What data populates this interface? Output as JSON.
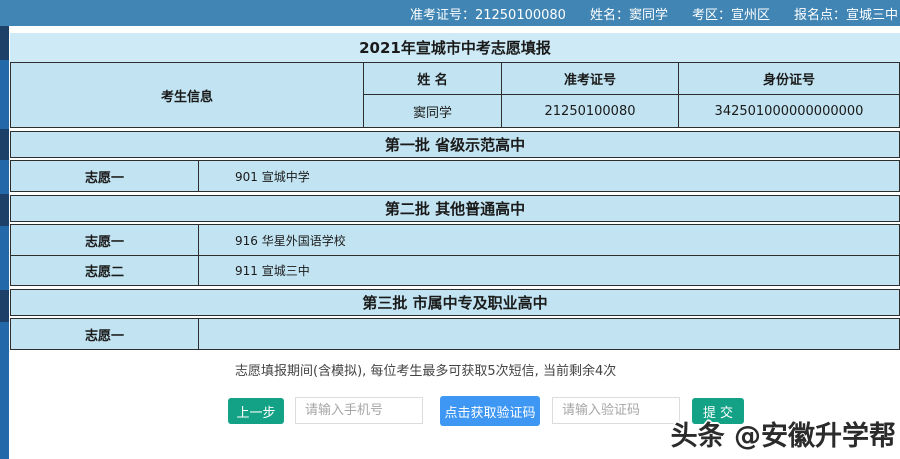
{
  "topbar": {
    "items": [
      "准考证号：21250100080",
      "姓名：窦同学",
      "考区：宣州区",
      "报名点：宣城三中"
    ]
  },
  "table": {
    "title": "2021年宣城市中考志愿填报",
    "info": {
      "row_header": "考生信息",
      "columns": [
        "姓 名",
        "准考证号",
        "身份证号"
      ],
      "values": [
        "窦同学",
        "21250100080",
        "342501000000000000"
      ]
    },
    "batches": [
      {
        "title": "第一批 省级示范高中",
        "rows": [
          {
            "label": "志愿一",
            "value": "901 宣城中学"
          }
        ]
      },
      {
        "title": "第二批 其他普通高中",
        "rows": [
          {
            "label": "志愿一",
            "value": "916 华星外国语学校"
          },
          {
            "label": "志愿二",
            "value": "911 宣城三中"
          }
        ]
      },
      {
        "title": "第三批 市属中专及职业高中",
        "rows": [
          {
            "label": "志愿一",
            "value": ""
          }
        ]
      }
    ]
  },
  "footer": {
    "note": "志愿填报期间(含模拟), 每位考生最多可获取5次短信, 当前剩余4次",
    "prev_button": "上一步",
    "phone_placeholder": "请输入手机号",
    "get_code_button": "点击获取验证码",
    "code_placeholder": "请输入验证码",
    "submit_button": "提 交"
  },
  "watermark": {
    "text": "头条 @安徽升学帮"
  },
  "colors": {
    "topbar_bg": "#4085b4",
    "panel_bg": "#c2e3f1",
    "left_strip": "#2166a8",
    "button_green": "#14a287",
    "button_blue": "#3e97f2"
  }
}
